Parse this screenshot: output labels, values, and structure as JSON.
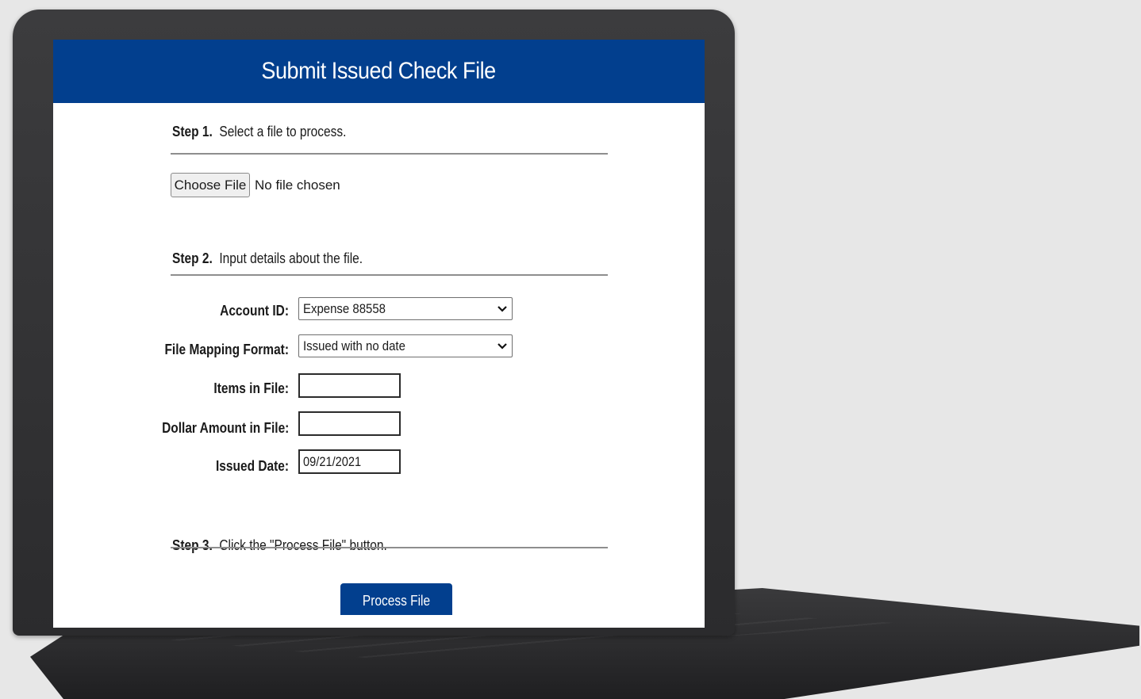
{
  "header": {
    "title": "Submit Issued Check File"
  },
  "step1": {
    "number": "Step 1.",
    "text": "Select a file to process."
  },
  "file_picker": {
    "button_label": "Choose File",
    "status": "No file chosen"
  },
  "step2": {
    "number": "Step 2.",
    "text": "Input details about the file."
  },
  "form": {
    "account_id": {
      "label": "Account ID:",
      "value": "Expense 88558"
    },
    "file_mapping_format": {
      "label": "File Mapping Format:",
      "value": "Issued with no date"
    },
    "items_in_file": {
      "label": "Items in File:",
      "value": ""
    },
    "dollar_amount": {
      "label": "Dollar Amount in File:",
      "value": ""
    },
    "issued_date": {
      "label": "Issued Date:",
      "value": "09/21/2021"
    }
  },
  "step3": {
    "number": "Step 3.",
    "text": "Click the \"Process File\" button."
  },
  "actions": {
    "process_label": "Process File"
  },
  "colors": {
    "brand_blue": "#023f8e",
    "background": "#e7e7e7",
    "laptop": "#2f2f31"
  },
  "icons": {
    "dropdown": "chevron-down-icon"
  }
}
